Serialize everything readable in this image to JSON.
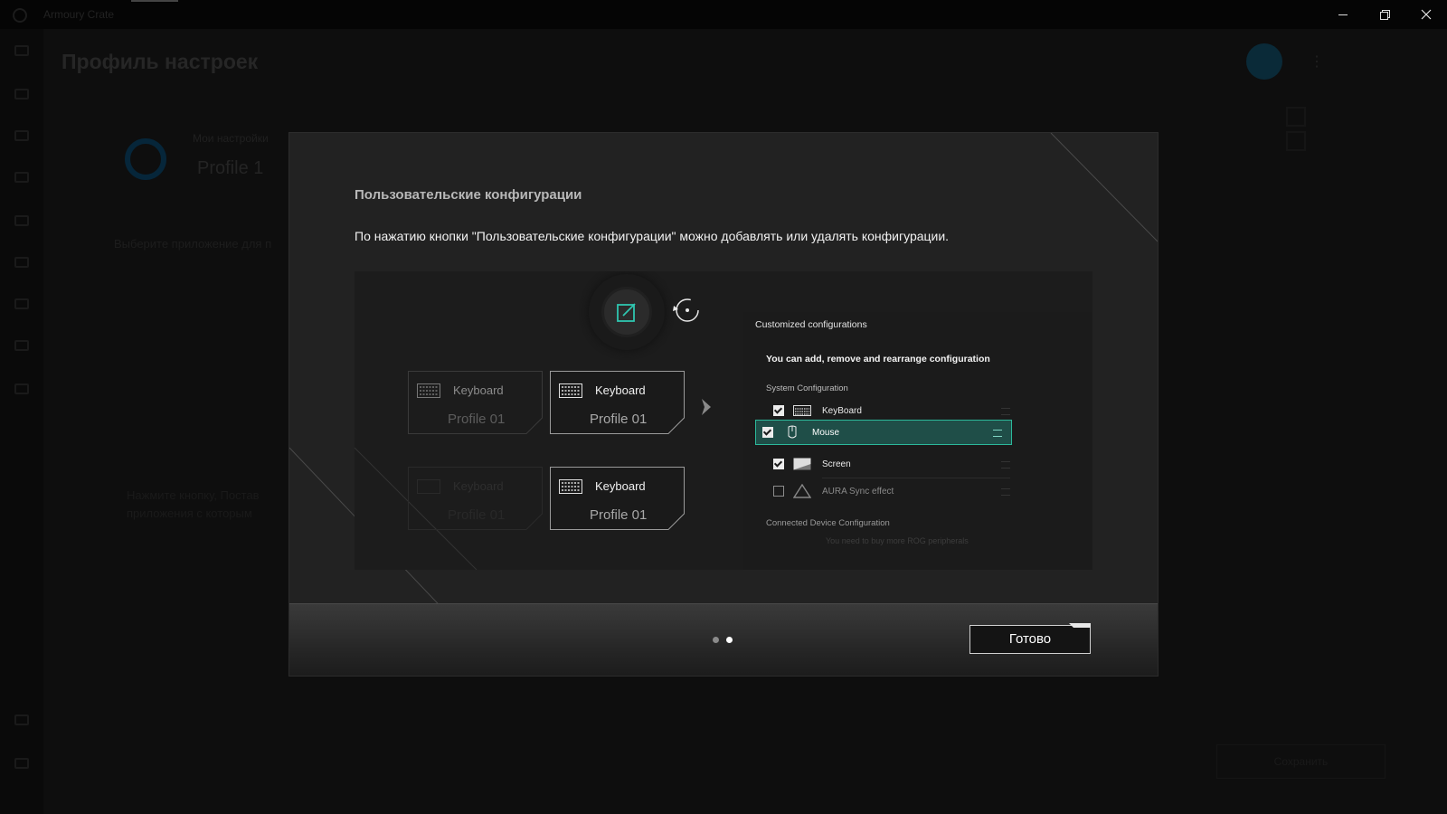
{
  "window": {
    "app_title": "Armoury Crate",
    "minimize_icon": "minimize-icon",
    "maximize_icon": "restore-icon",
    "close_icon": "close-icon"
  },
  "background_page": {
    "title": "Профиль настроек",
    "profile_label": "Мои настройки",
    "profile_name": "Profile 1",
    "hint": "Выберите приложение для п",
    "description": "Нажмите кнопку, Постав приложения с которым",
    "action_button": "Сохранить"
  },
  "modal": {
    "title": "Пользовательские конфигурации",
    "description": "По нажатию кнопки \"Пользовательские конфигурации\" можно добавлять или удалять конфигурации.",
    "illustration": {
      "edit_icon": "edit-square-icon",
      "reload_icon": "refresh-cursor-icon",
      "cards": [
        {
          "title": "Keyboard",
          "subtitle": "Profile 01"
        },
        {
          "title": "Keyboard",
          "subtitle": "Profile 01"
        },
        {
          "title": "Keyboard",
          "subtitle": "Profile 01"
        },
        {
          "title": "Keyboard",
          "subtitle": "Profile 01"
        }
      ],
      "config_panel": {
        "title": "Customized configurations",
        "subtitle": "You can add, remove and rearrange configuration",
        "section_system": "System Configuration",
        "items": [
          {
            "label": "KeyBoard",
            "checked": true
          },
          {
            "label": "Mouse",
            "checked": true,
            "selected": true
          },
          {
            "label": "Screen",
            "checked": true
          },
          {
            "label": "AURA Sync effect",
            "checked": false
          }
        ],
        "section_connected": "Connected Device Configuration",
        "note": "You need to buy more ROG peripherals"
      }
    },
    "pagination": {
      "total": 2,
      "active": 1
    },
    "done_button": "Готово"
  },
  "colors": {
    "accent_teal": "#2cb89a",
    "selected_row_bg": "#1f4e48",
    "modal_bg": "#222222"
  }
}
